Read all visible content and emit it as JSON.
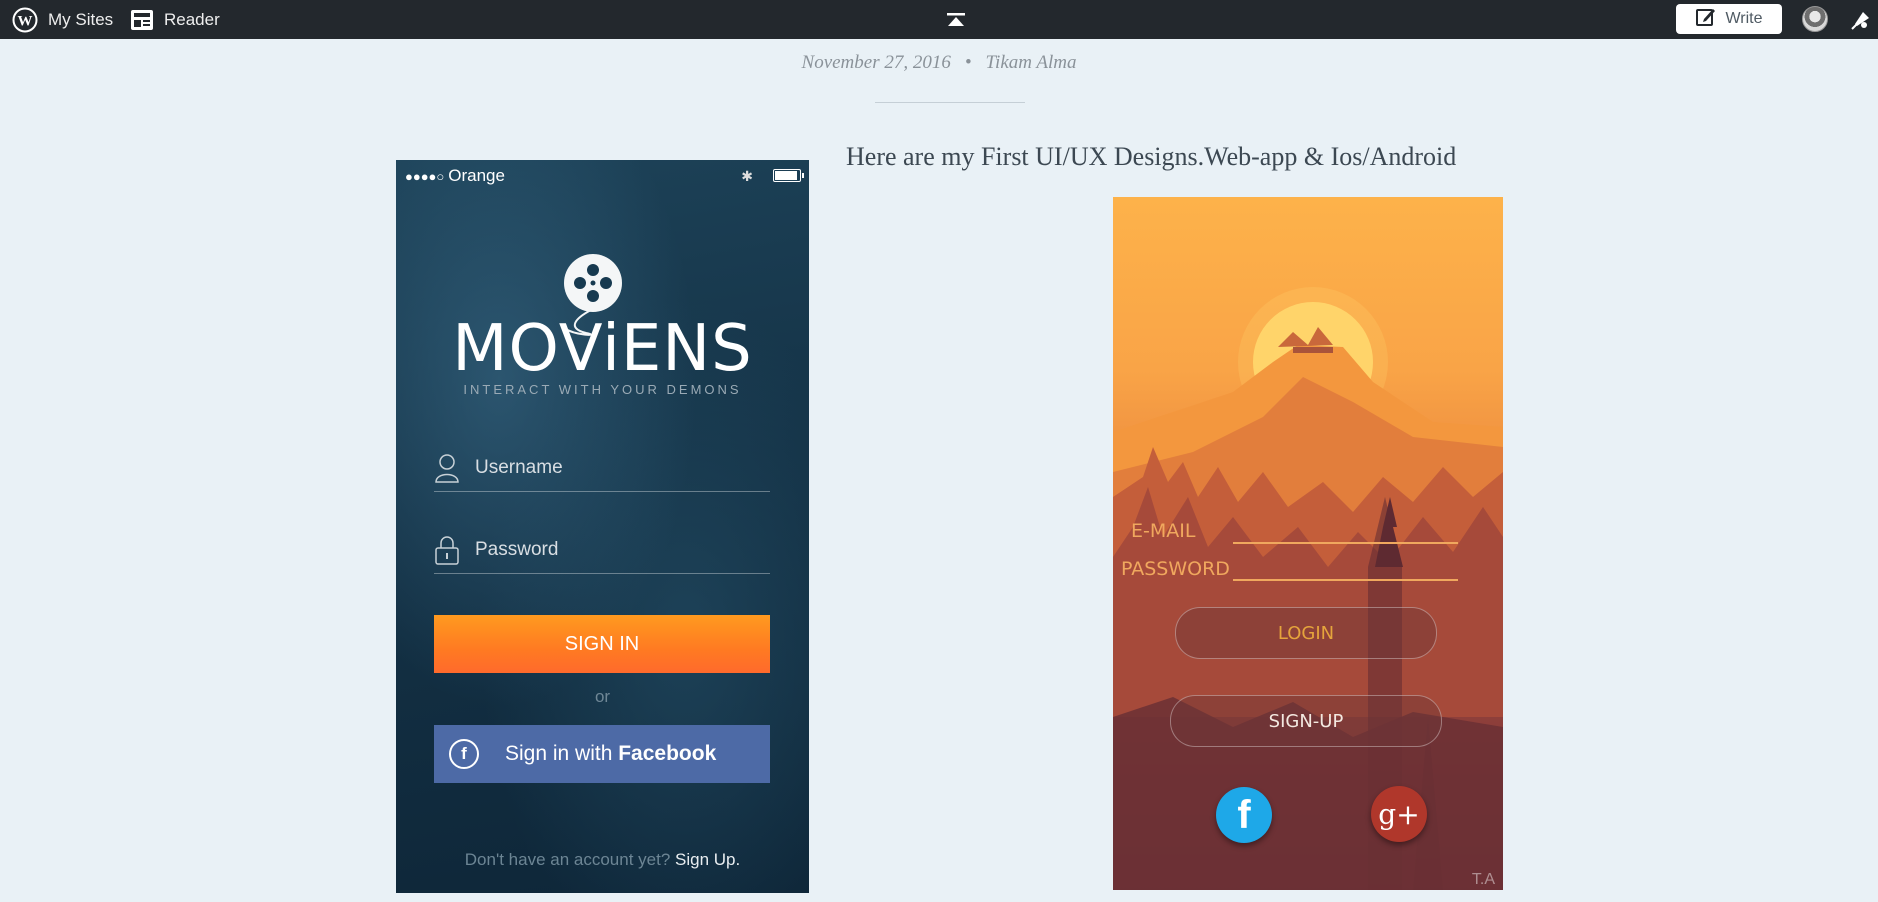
{
  "topbar": {
    "my_sites": "My Sites",
    "reader": "Reader",
    "write": "Write",
    "icons": [
      "wordpress-icon",
      "reader-icon",
      "collapse-up-icon",
      "write-icon",
      "avatar",
      "notifications-icon"
    ]
  },
  "post": {
    "date": "November 27, 2016",
    "separator": "•",
    "author": "Tikam Alma",
    "title": "Here are my First UI/UX Designs.Web-app & Ios/Android"
  },
  "moviens": {
    "carrier_signal": "●●●●○",
    "carrier": "Orange",
    "bluetooth": "✱",
    "brand": "MOViENS",
    "tagline": "INTERACT WITH YOUR DEMONS",
    "username_placeholder": "Username",
    "password_placeholder": "Password",
    "sign_in": "SIGN IN",
    "or": "or",
    "fb_icon": "f",
    "fb_prefix": "Sign in with ",
    "fb_bold": "Facebook",
    "footer_question": "Don't have an account yet? ",
    "footer_signup": "Sign Up.",
    "colors": {
      "signin": "#ff7a22",
      "facebook": "#4d6aa6",
      "bg": "#143246"
    }
  },
  "firewatch": {
    "email_label": "E-MAIL",
    "password_label": "PASSWORD",
    "login": "LOGIN",
    "signup": "SIGN-UP",
    "fb_icon": "f",
    "gplus_icon": "g+",
    "signature": "T.A",
    "colors": {
      "accent": "#f0a85e",
      "facebook": "#1ea8e8",
      "gplus": "#b0372b"
    }
  }
}
